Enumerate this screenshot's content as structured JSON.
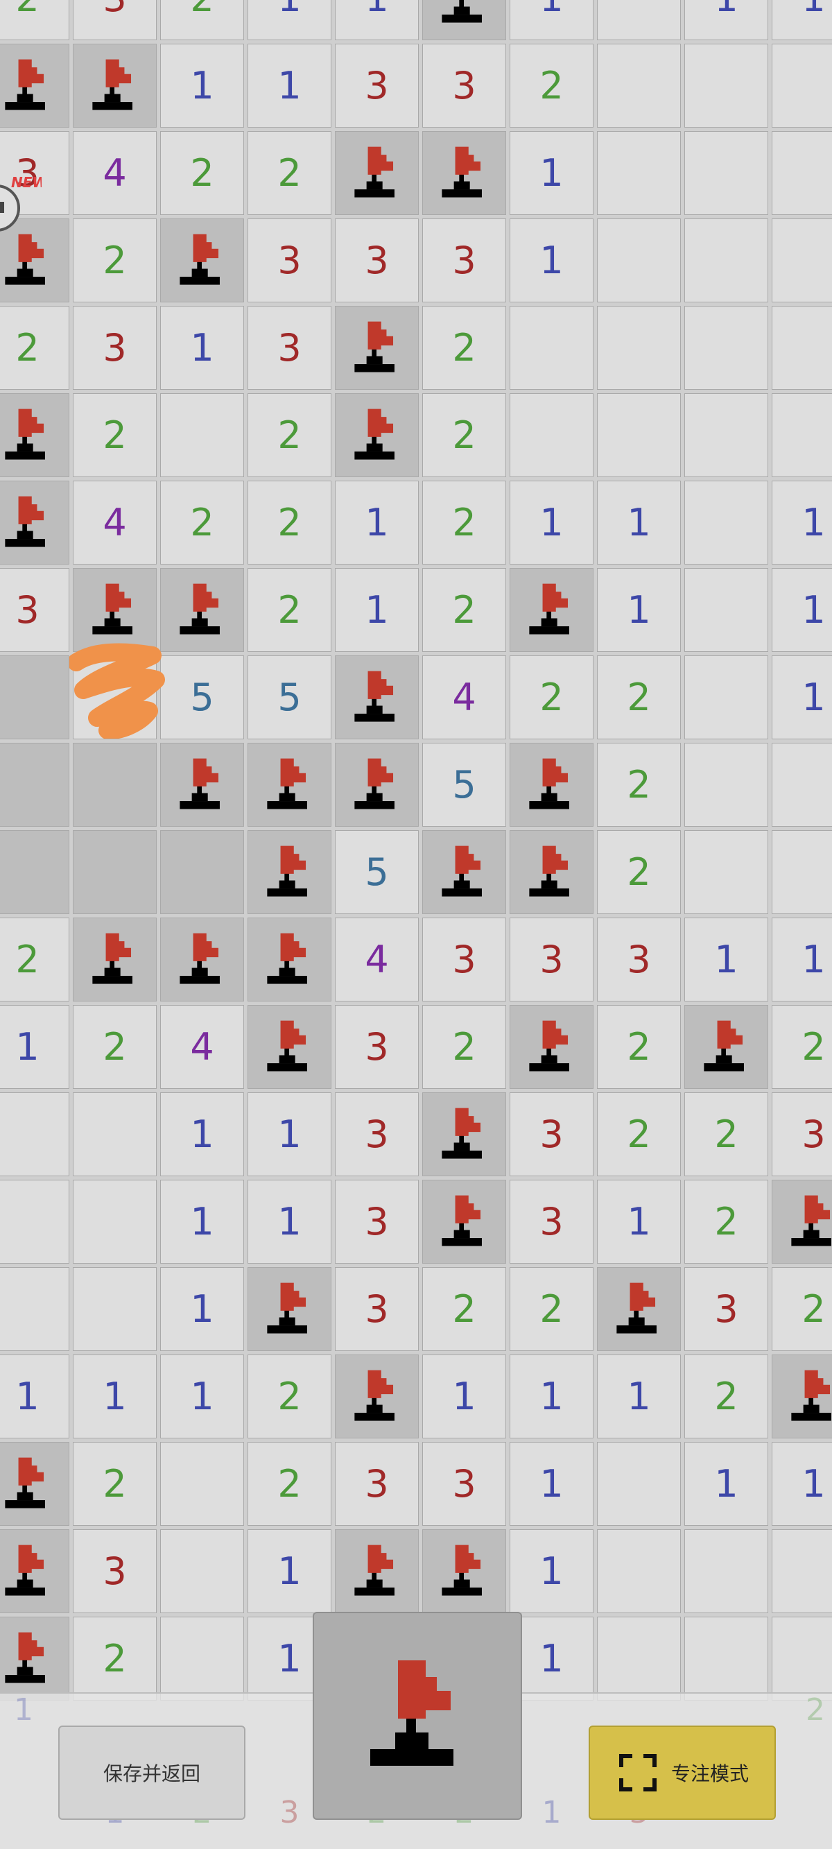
{
  "board": {
    "rows": [
      [
        "2",
        "3",
        "2",
        "1",
        "1",
        "F",
        "1",
        "",
        "1",
        "1"
      ],
      [
        "F",
        "F",
        "1",
        "1",
        "3",
        "3",
        "2",
        "",
        "",
        ""
      ],
      [
        "3",
        "4",
        "2",
        "2",
        "F",
        "F",
        "1",
        "",
        "",
        ""
      ],
      [
        "F",
        "2",
        "F",
        "3",
        "3",
        "3",
        "1",
        "",
        "",
        ""
      ],
      [
        "2",
        "3",
        "1",
        "3",
        "F",
        "2",
        "",
        "",
        "",
        ""
      ],
      [
        "F",
        "2",
        "",
        "2",
        "F",
        "2",
        "",
        "",
        "",
        ""
      ],
      [
        "F",
        "4",
        "2",
        "2",
        "1",
        "2",
        "1",
        "1",
        "",
        "1"
      ],
      [
        "3",
        "F",
        "F",
        "2",
        "1",
        "2",
        "F",
        "1",
        "",
        "1"
      ],
      [
        "C",
        "",
        "5",
        "5",
        "F",
        "4",
        "2",
        "2",
        "",
        "1"
      ],
      [
        "C",
        "C",
        "F",
        "F",
        "F",
        "5",
        "F",
        "2",
        "",
        ""
      ],
      [
        "C",
        "C",
        "C",
        "F",
        "5",
        "F",
        "F",
        "2",
        "",
        ""
      ],
      [
        "2",
        "F",
        "F",
        "F",
        "4",
        "3",
        "3",
        "3",
        "1",
        "1"
      ],
      [
        "1",
        "2",
        "4",
        "F",
        "3",
        "2",
        "F",
        "2",
        "F",
        "2"
      ],
      [
        "",
        "",
        "1",
        "1",
        "3",
        "F",
        "3",
        "2",
        "2",
        "3"
      ],
      [
        "",
        "",
        "1",
        "1",
        "3",
        "F",
        "3",
        "1",
        "2",
        "F"
      ],
      [
        "",
        "",
        "1",
        "F",
        "3",
        "2",
        "2",
        "F",
        "3",
        "2"
      ],
      [
        "1",
        "1",
        "1",
        "2",
        "F",
        "1",
        "1",
        "1",
        "2",
        "F"
      ],
      [
        "F",
        "2",
        "",
        "2",
        "3",
        "3",
        "1",
        "",
        "1",
        "1"
      ],
      [
        "F",
        "3",
        "",
        "1",
        "F",
        "F",
        "1",
        "",
        "",
        ""
      ],
      [
        "F",
        "2",
        "",
        "1",
        "",
        "",
        "1",
        "",
        "",
        ""
      ]
    ]
  },
  "controls": {
    "save_label": "保存并返回",
    "focus_label": "专注模式",
    "mode": "flag"
  },
  "badge_text": "NEW!",
  "ghost_row": [
    "",
    "1",
    "2",
    "3",
    "2",
    "2",
    "1",
    "3",
    "",
    ""
  ],
  "ghost_left": "1",
  "ghost_right": "2",
  "colors": {
    "n1": "#3d47a8",
    "n2": "#4c9a3a",
    "n3": "#a02828",
    "n4": "#7a2b9e",
    "n5": "#3b6e96",
    "flag_red": "#c0392b",
    "accent_focus": "#d6c04a"
  }
}
